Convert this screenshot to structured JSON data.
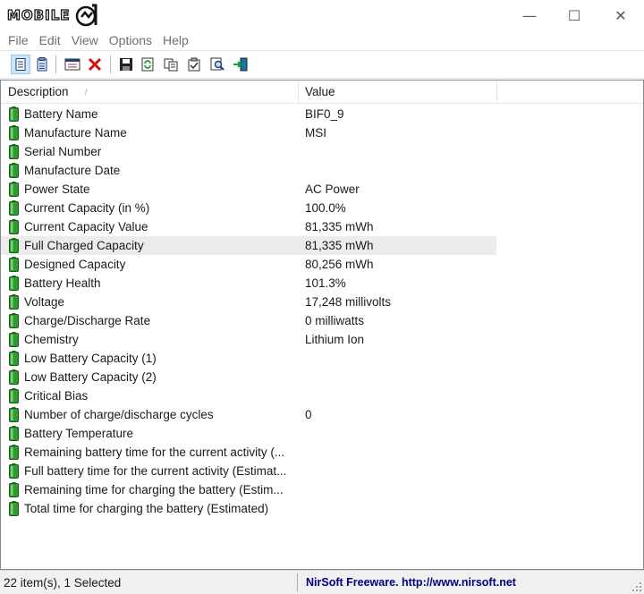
{
  "window": {
    "logo_text": "MOBILE",
    "controls": {
      "minimize": "—",
      "maximize": "☐",
      "close": "✕"
    }
  },
  "menu": [
    "File",
    "Edit",
    "View",
    "Options",
    "Help"
  ],
  "toolbar": {
    "buttons": [
      "html-report-icon",
      "text-report-icon",
      "properties-window-icon",
      "delete-icon",
      "save-icon",
      "refresh-icon",
      "copy-icon",
      "properties-icon",
      "find-icon",
      "exit-icon"
    ]
  },
  "list": {
    "columns": [
      "Description",
      "Value"
    ],
    "sort_indicator": "/",
    "rows": [
      {
        "desc": "Battery Name",
        "value": "BIF0_9"
      },
      {
        "desc": "Manufacture Name",
        "value": "MSI"
      },
      {
        "desc": "Serial Number",
        "value": ""
      },
      {
        "desc": "Manufacture Date",
        "value": ""
      },
      {
        "desc": "Power State",
        "value": "AC Power"
      },
      {
        "desc": "Current Capacity (in %)",
        "value": "100.0%"
      },
      {
        "desc": "Current Capacity Value",
        "value": "81,335 mWh"
      },
      {
        "desc": "Full Charged Capacity",
        "value": "81,335 mWh",
        "selected": true
      },
      {
        "desc": "Designed Capacity",
        "value": "80,256 mWh"
      },
      {
        "desc": "Battery Health",
        "value": "101.3%"
      },
      {
        "desc": "Voltage",
        "value": "17,248 millivolts"
      },
      {
        "desc": "Charge/Discharge Rate",
        "value": "0 milliwatts"
      },
      {
        "desc": "Chemistry",
        "value": "Lithium Ion"
      },
      {
        "desc": "Low Battery Capacity (1)",
        "value": ""
      },
      {
        "desc": "Low Battery Capacity (2)",
        "value": ""
      },
      {
        "desc": "Critical Bias",
        "value": ""
      },
      {
        "desc": "Number of charge/discharge cycles",
        "value": "0"
      },
      {
        "desc": "Battery Temperature",
        "value": ""
      },
      {
        "desc": "Remaining battery time for the current activity (...",
        "value": ""
      },
      {
        "desc": "Full battery time for the current activity (Estimat...",
        "value": ""
      },
      {
        "desc": "Remaining time for charging the battery (Estim...",
        "value": ""
      },
      {
        "desc": "Total  time for charging the battery (Estimated)",
        "value": ""
      }
    ]
  },
  "status": {
    "count": "22 item(s), 1 Selected",
    "link": "NirSoft Freeware.  http://www.nirsoft.net"
  },
  "colors": {
    "battery_green": "#2e9b2e",
    "link_blue": "#000080",
    "selection_gray": "#ececec"
  }
}
